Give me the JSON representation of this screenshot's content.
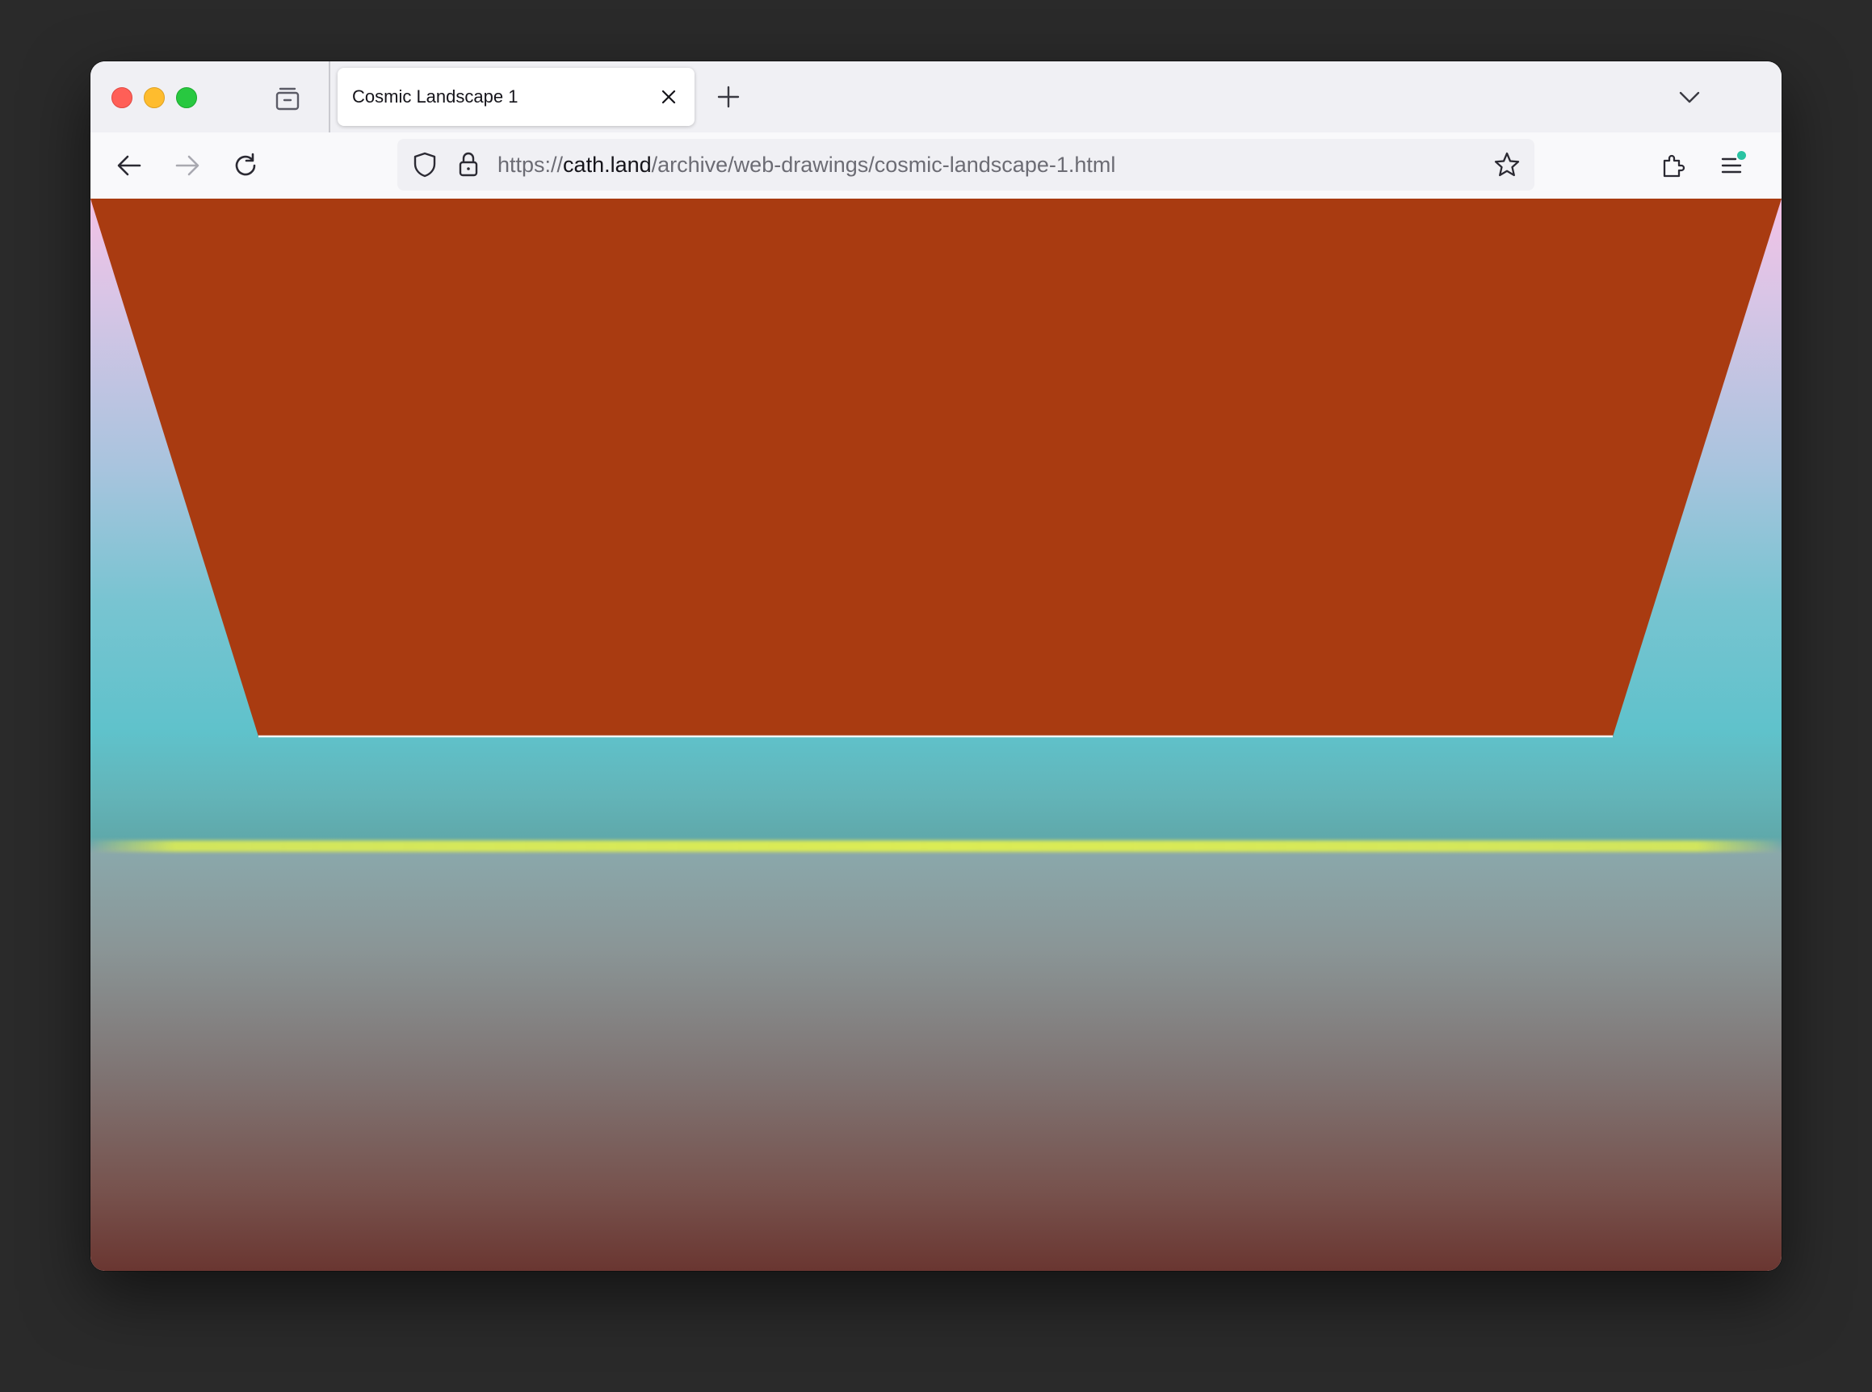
{
  "window": {
    "controls": [
      "close",
      "minimize",
      "maximize"
    ]
  },
  "tabs": [
    {
      "title": "Cosmic Landscape 1",
      "active": true
    }
  ],
  "toolbar": {
    "back_icon": "arrow-left-icon",
    "forward_icon": "arrow-right-icon",
    "reload_icon": "reload-icon",
    "extensions_icon": "puzzle-icon",
    "menu_icon": "hamburger-icon"
  },
  "urlbar": {
    "scheme": "https://",
    "host": "cath.land",
    "path": "/archive/web-drawings/cosmic-landscape-1.html"
  },
  "colors": {
    "trapezoid": "#a93b11",
    "horizon_glow": "#e1f050",
    "sky_top": "#f3c2e6",
    "sky_mid": "#5fc2cb",
    "ground_bottom": "#6a3631"
  }
}
